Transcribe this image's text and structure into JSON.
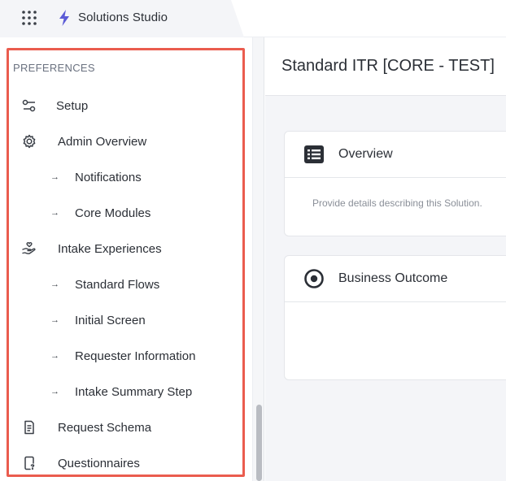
{
  "header": {
    "app_title": "Solutions Studio",
    "accent_color": "#5b5bd6"
  },
  "sidebar": {
    "section_label": "PREFERENCES",
    "highlight_color": "#ea5c4e",
    "items": [
      {
        "label": "Setup",
        "icon": "sliders-icon",
        "level": 0
      },
      {
        "label": "Admin Overview",
        "icon": "gear-icon",
        "level": 0
      },
      {
        "label": "Notifications",
        "icon": "arrow-right-icon",
        "level": 1
      },
      {
        "label": "Core Modules",
        "icon": "arrow-right-icon",
        "level": 1
      },
      {
        "label": "Intake Experiences",
        "icon": "hand-heart-icon",
        "level": 0
      },
      {
        "label": "Standard Flows",
        "icon": "arrow-right-icon",
        "level": 1
      },
      {
        "label": "Initial Screen",
        "icon": "arrow-right-icon",
        "level": 1
      },
      {
        "label": "Requester Information",
        "icon": "arrow-right-icon",
        "level": 1
      },
      {
        "label": "Intake Summary Step",
        "icon": "arrow-right-icon",
        "level": 1
      },
      {
        "label": "Request Schema",
        "icon": "document-icon",
        "level": 0
      },
      {
        "label": "Questionnaires",
        "icon": "question-document-icon",
        "level": 0
      }
    ]
  },
  "main": {
    "page_title": "Standard ITR [CORE - TEST]",
    "cards": [
      {
        "title": "Overview",
        "icon": "list-icon",
        "description": "Provide details describing this Solution."
      },
      {
        "title": "Business Outcome",
        "icon": "target-icon",
        "description": ""
      }
    ]
  }
}
